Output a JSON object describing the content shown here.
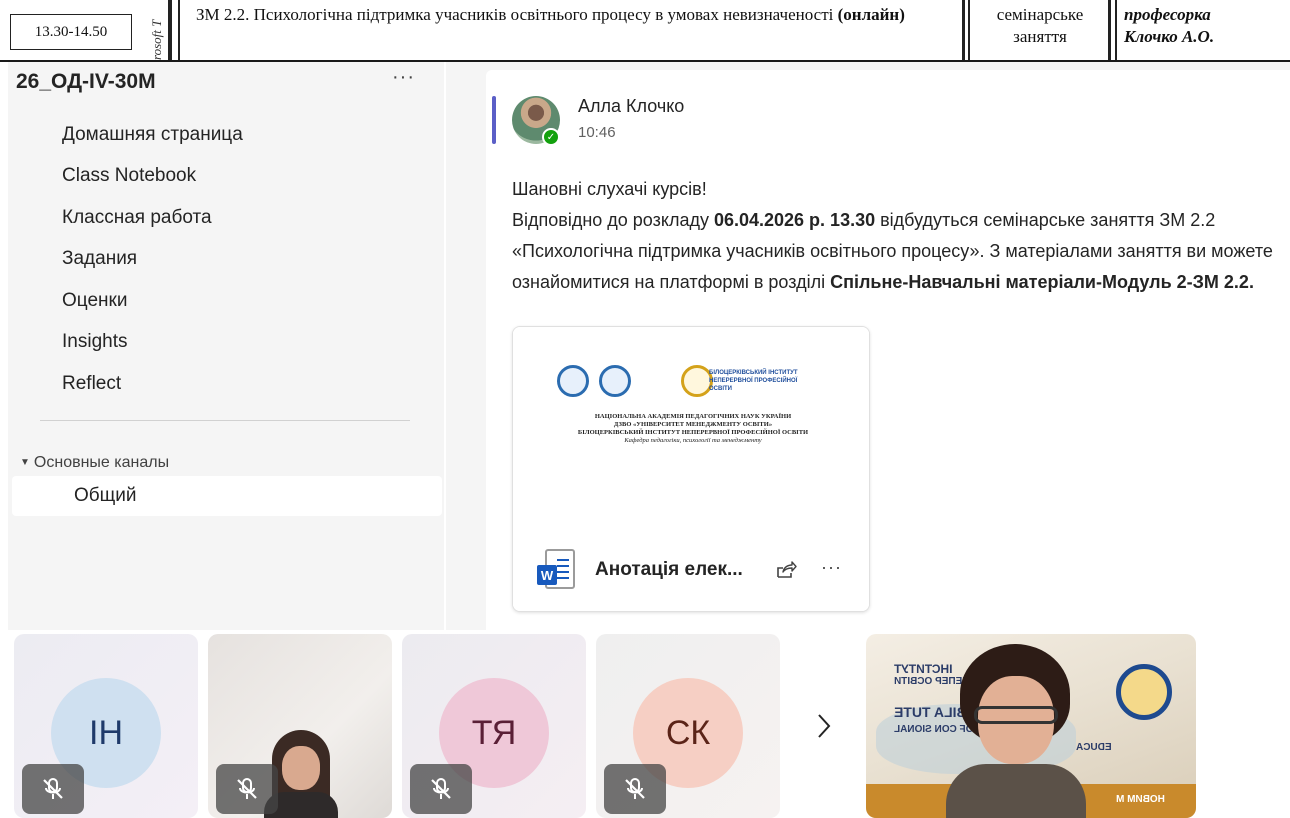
{
  "schedule": {
    "time": "13.30-14.50",
    "side_text": "rosoft T",
    "subject_normal": "ЗМ 2.2. Психологічна підтримка учасників освітнього процесу в умовах невизначеності ",
    "subject_bold": "(онлайн)",
    "type_line1": "семінарське",
    "type_line2": "заняття",
    "teacher_line1": "професорка",
    "teacher_line2": "Клочко А.О."
  },
  "sidebar": {
    "team_name": "26_ОД-IV-30М",
    "more": "···",
    "items": [
      {
        "label": "Домашняя страница"
      },
      {
        "label": "Class Notebook"
      },
      {
        "label": "Классная работа"
      },
      {
        "label": "Задания"
      },
      {
        "label": "Оценки"
      },
      {
        "label": "Insights"
      },
      {
        "label": "Reflect"
      }
    ],
    "channels_header": "Основные каналы",
    "channels": [
      {
        "label": "Общий"
      }
    ]
  },
  "post": {
    "author": "Алла Клочко",
    "time": "10:46",
    "greeting": "Шановні слухачі курсів!",
    "p1": "Відповідно до розкладу ",
    "p1_bold": "06.04.2026 р. 13.30",
    "p1_rest": " відбудуться семінарське заняття ЗМ 2.2 «Психологічна підтримка учасників освітнього процесу». З матеріалами заняття ви можете ознайомитися на платформі в розділі ",
    "p1_bold2": "Спільне-Навчальні матеріали-Модуль 2-ЗМ 2.2.",
    "attachment": {
      "file_name": "Анотація елек...",
      "more": "···",
      "preview_institute": "БІЛОЦЕРКІВСЬКИЙ ІНСТИТУТ НЕПЕРЕРВНОЇ ПРОФЕСІЙНОЇ ОСВІТИ",
      "preview_line1": "НАЦІОНАЛЬНА АКАДЕМІЯ ПЕДАГОГІЧНИХ НАУК УКРАЇНИ",
      "preview_line2": "ДЗВО «УНІВЕРСИТЕТ МЕНЕДЖМЕНТУ ОСВІТИ»",
      "preview_line3": "БІЛОЦЕРКІВСЬКИЙ ІНСТИТУТ НЕПЕРЕРВНОЇ ПРОФЕСІЙНОЇ ОСВІТИ",
      "preview_line4": "Кафедра педагогіки, психології та менеджменту"
    }
  },
  "gallery": {
    "participants": [
      {
        "initials": "ІН",
        "muted": true
      },
      {
        "initials": "",
        "muted": true,
        "video": true
      },
      {
        "initials": "ТЯ",
        "muted": true
      },
      {
        "initials": "СК",
        "muted": true
      }
    ],
    "next": "›",
    "speaker_banner": [
      "ІНСТИТУТ",
      "НЕПЕР ОСВІТИ",
      "BILA TUTE",
      "OF CON SIONAL",
      "EDUCA",
      "НОВИМ М"
    ]
  },
  "colors": {
    "accent": "#5b5fc7",
    "presence": "#13a10e",
    "word": "#185abd"
  }
}
